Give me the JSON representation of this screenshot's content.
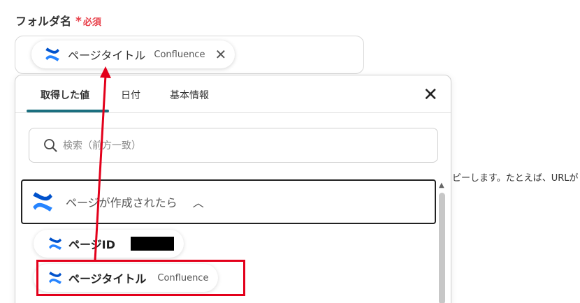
{
  "field": {
    "label": "フォルダ名",
    "required_star": "*",
    "required_text": "必須"
  },
  "selected_chip": {
    "title": "ページタイトル",
    "source": "Confluence",
    "remove_glyph": "✕",
    "icon": "confluence-icon"
  },
  "dropdown": {
    "tabs": [
      {
        "label": "取得した値",
        "active": true
      },
      {
        "label": "日付",
        "active": false
      },
      {
        "label": "基本情報",
        "active": false
      }
    ],
    "close_glyph": "✕",
    "search_placeholder": "検索（前方一致）",
    "group": {
      "title": "ページが作成されたら",
      "expanded": true,
      "chevron_glyph": "︿"
    },
    "items": [
      {
        "title": "ページID",
        "value_redacted": true
      },
      {
        "title": "ページタイトル",
        "source": "Confluence",
        "highlighted": true
      }
    ]
  },
  "background_text": "ピーします。たとえば、URLが",
  "colors": {
    "accent_tab": "#1b6f7f",
    "required": "#e8414b",
    "annotation_red": "#e3001b",
    "confluence_blue_light": "#2684ff",
    "confluence_blue_dark": "#0052cc"
  }
}
